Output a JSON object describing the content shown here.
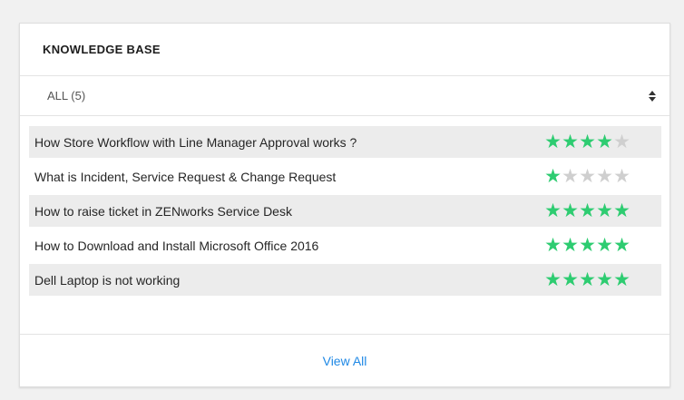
{
  "widget": {
    "title": "KNOWLEDGE BASE",
    "filter": {
      "selected": "ALL (5)",
      "icon": "sort-arrows-icon"
    },
    "articles": [
      {
        "title": "How Store Workflow with Line Manager Approval works ?",
        "rating": 4,
        "max_rating": 5
      },
      {
        "title": "What is Incident, Service Request & Change Request",
        "rating": 1,
        "max_rating": 5
      },
      {
        "title": "How to raise ticket in ZENworks Service Desk",
        "rating": 5,
        "max_rating": 5
      },
      {
        "title": "How to Download and Install Microsoft Office 2016",
        "rating": 5,
        "max_rating": 5
      },
      {
        "title": "Dell Laptop is not working",
        "rating": 5,
        "max_rating": 5
      }
    ],
    "footer": {
      "view_all_label": "View All"
    }
  },
  "colors": {
    "star_on": "#2ecc71",
    "star_off": "#cfcfcf",
    "link": "#1e88e5",
    "row_alt": "#ececec"
  }
}
